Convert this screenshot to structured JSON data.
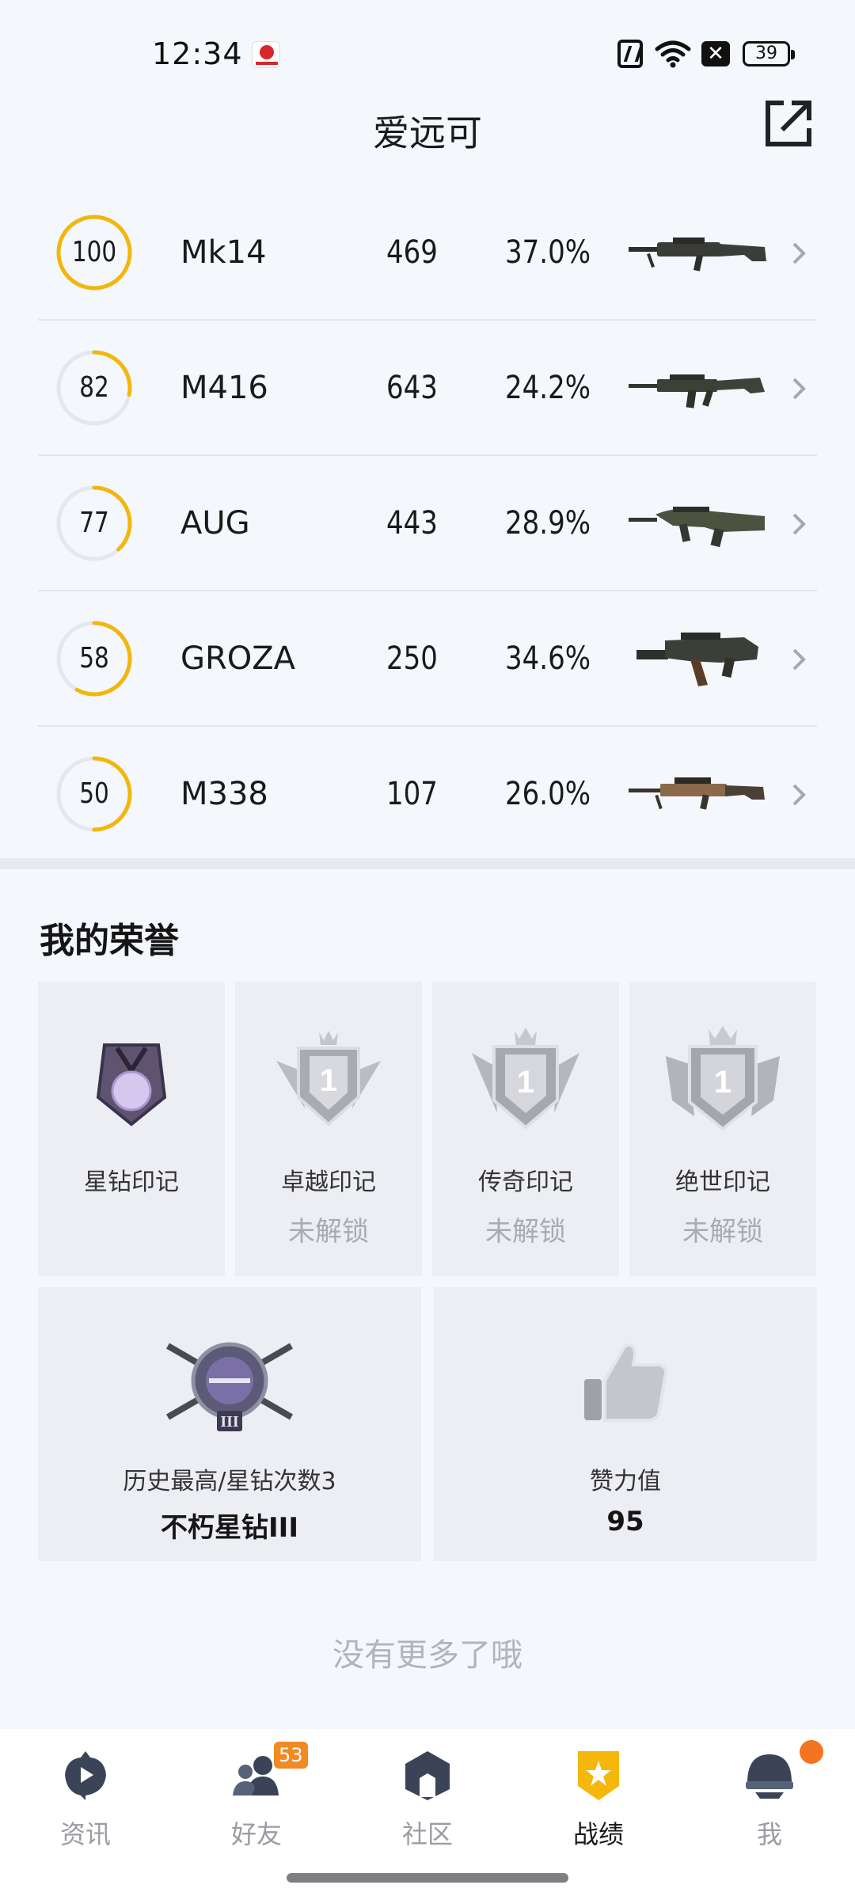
{
  "status_bar": {
    "time": "12:34",
    "battery": "39",
    "icons": [
      "app-notification-icon",
      "nfc-icon",
      "wifi-icon",
      "x-notification-icon",
      "battery-icon"
    ]
  },
  "header": {
    "title": "爱远可",
    "share_icon": "share-external-icon"
  },
  "weapons": [
    {
      "score": "100",
      "score_fraction": 1.0,
      "name": "Mk14",
      "kills": "469",
      "rate": "37.0%"
    },
    {
      "score": "82",
      "score_fraction": 0.28,
      "name": "M416",
      "kills": "643",
      "rate": "24.2%"
    },
    {
      "score": "77",
      "score_fraction": 0.38,
      "name": "AUG",
      "kills": "443",
      "rate": "28.9%"
    },
    {
      "score": "58",
      "score_fraction": 0.58,
      "name": "GROZA",
      "kills": "250",
      "rate": "34.6%"
    },
    {
      "score": "50",
      "score_fraction": 0.5,
      "name": "M338",
      "kills": "107",
      "rate": "26.0%"
    }
  ],
  "colors": {
    "ring_progress": "#f2b70c",
    "ring_track": "#e4e7ee",
    "badge_orange": "#f08a24",
    "active_tab": "#f4b70a"
  },
  "honors": {
    "title": "我的荣誉",
    "marks": [
      {
        "name": "星钻印记",
        "status": ""
      },
      {
        "name": "卓越印记",
        "status": "未解锁"
      },
      {
        "name": "传奇印记",
        "status": "未解锁"
      },
      {
        "name": "绝世印记",
        "status": "未解锁"
      }
    ],
    "rank_badge_text": "1",
    "rank_card": {
      "label": "历史最高/星钻次数3",
      "value": "不朽星钻III"
    },
    "likes_card": {
      "label": "赞力值",
      "value": "95"
    }
  },
  "footer_text": "没有更多了哦",
  "bottom_nav": [
    {
      "label": "资讯",
      "icon": "news-play-icon",
      "active": false,
      "badge": ""
    },
    {
      "label": "好友",
      "icon": "friends-icon",
      "active": false,
      "badge": "53"
    },
    {
      "label": "社区",
      "icon": "community-icon",
      "active": false,
      "badge": ""
    },
    {
      "label": "战绩",
      "icon": "record-shield-icon",
      "active": true,
      "badge": ""
    },
    {
      "label": "我",
      "icon": "helmet-icon",
      "active": false,
      "badge": "dot"
    }
  ]
}
